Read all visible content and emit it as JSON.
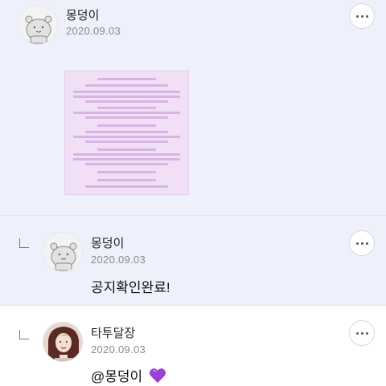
{
  "comments": [
    {
      "username": "몽덩이",
      "date": "2020.09.03",
      "avatar": "bear-avatar"
    },
    {
      "username": "몽덩이",
      "date": "2020.09.03",
      "avatar": "bear-avatar",
      "text": "공지확인완료!"
    },
    {
      "username": "타투달장",
      "date": "2020.09.03",
      "avatar": "profile-photo",
      "text": "@몽덩이",
      "emoji": "purple-heart-icon"
    }
  ],
  "colors": {
    "reply_bg": "#eef1fb",
    "heart": "#9b3fd6",
    "notice_bg": "#f1dff6"
  }
}
